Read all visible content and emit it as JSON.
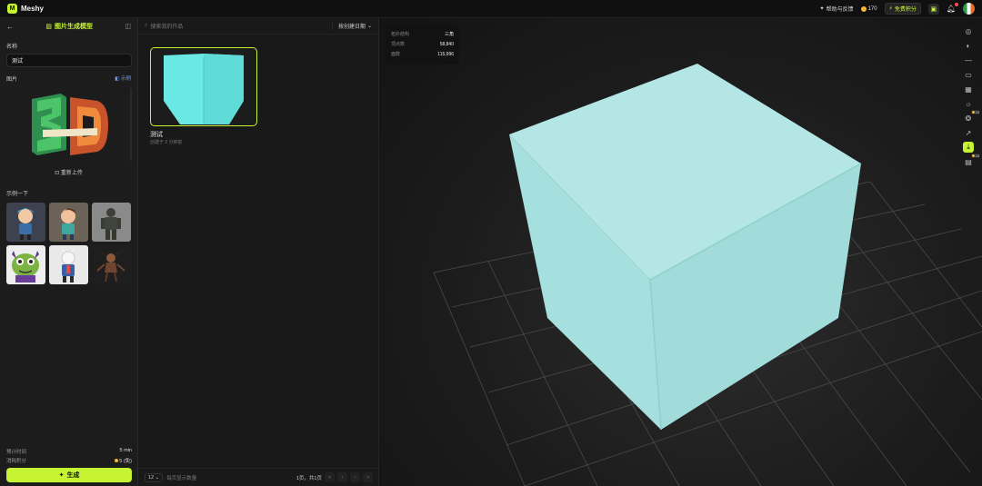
{
  "app": {
    "name": "Meshy",
    "logo_letter": "M"
  },
  "topbar": {
    "link_label": "帮助与反馈",
    "credits": "170",
    "upgrade_label": "免费积分",
    "icons": [
      "sparkle-icon",
      "coin-icon",
      "lightning-icon",
      "gift-icon",
      "bell-icon",
      "avatar"
    ]
  },
  "left_panel": {
    "title": "图片生成模型",
    "name_label": "名称",
    "name_value": "测试",
    "image_label": "图片",
    "example_label": "示例",
    "reupload_label": "重新上传",
    "samples_label": "示例一下",
    "samples": [
      "sample-character-1",
      "sample-character-2",
      "sample-character-3",
      "sample-character-4",
      "sample-character-5",
      "sample-character-6"
    ],
    "footer": {
      "time_label": "预计时间",
      "time_value": "5 min",
      "cost_label": "消耗积分",
      "cost_value": "5 (免)"
    },
    "generate_label": "生成"
  },
  "middle_panel": {
    "search_placeholder": "搜索我的作品",
    "sort_label": "按创建日期",
    "card": {
      "title": "测试",
      "subtitle": "创建于 2 分钟前"
    },
    "footer": {
      "page_size": "12",
      "per_page_label": "每页显示数量",
      "page_info": "1页，共1页"
    }
  },
  "viewer": {
    "stats": [
      {
        "label": "拓扑结构",
        "value": "三角"
      },
      {
        "label": "顶点数",
        "value": "58,840"
      },
      {
        "label": "面数",
        "value": "115,996"
      }
    ],
    "model_color": "#a8e2e2",
    "badges": {
      "remesh": "20",
      "texture": "20"
    }
  },
  "colors": {
    "accent": "#c6f432",
    "background": "#141414"
  }
}
